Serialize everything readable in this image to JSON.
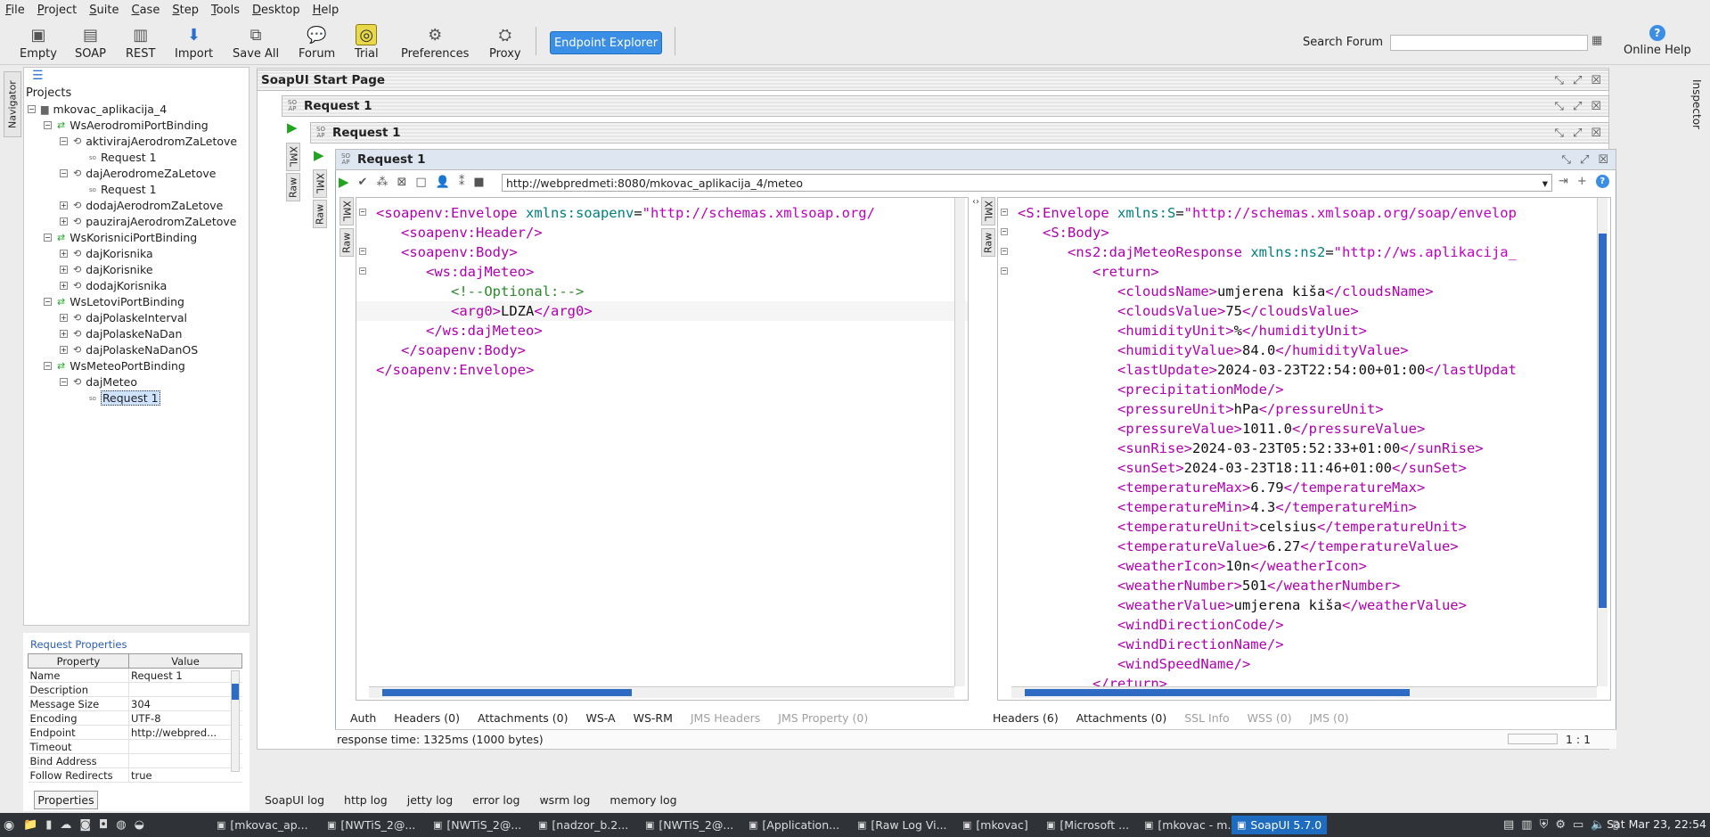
{
  "menu": [
    "File",
    "Project",
    "Suite",
    "Case",
    "Step",
    "Tools",
    "Desktop",
    "Help"
  ],
  "toolbar": {
    "empty": "Empty",
    "soap": "SOAP",
    "rest": "REST",
    "import": "Import",
    "save_all": "Save All",
    "forum": "Forum",
    "trial": "Trial",
    "preferences": "Preferences",
    "proxy": "Proxy",
    "endpoint_explorer": "Endpoint Explorer",
    "search_label": "Search Forum",
    "search_value": "",
    "online_help": "Online Help"
  },
  "side_tabs": {
    "navigator": "Navigator",
    "inspector": "Inspector"
  },
  "navigator": {
    "root_label": "Projects",
    "items": [
      {
        "label": "mkovac_aplikacija_4",
        "kind": "project"
      },
      {
        "label": "WsAerodromiPortBinding",
        "kind": "binding"
      },
      {
        "label": "aktivirajAerodromZaLetove",
        "kind": "op"
      },
      {
        "label": "Request 1",
        "kind": "req"
      },
      {
        "label": "dajAerodromeZaLetove",
        "kind": "op"
      },
      {
        "label": "Request 1",
        "kind": "req"
      },
      {
        "label": "dodajAerodromZaLetove",
        "kind": "op"
      },
      {
        "label": "pauzirajAerodromZaLetove",
        "kind": "op"
      },
      {
        "label": "WsKorisniciPortBinding",
        "kind": "binding"
      },
      {
        "label": "dajKorisnika",
        "kind": "op"
      },
      {
        "label": "dajKorisnike",
        "kind": "op"
      },
      {
        "label": "dodajKorisnika",
        "kind": "op"
      },
      {
        "label": "WsLetoviPortBinding",
        "kind": "binding"
      },
      {
        "label": "dajPolaskeInterval",
        "kind": "op"
      },
      {
        "label": "dajPolaskeNaDan",
        "kind": "op"
      },
      {
        "label": "dajPolaskeNaDanOS",
        "kind": "op"
      },
      {
        "label": "WsMeteoPortBinding",
        "kind": "binding"
      },
      {
        "label": "dajMeteo",
        "kind": "op"
      },
      {
        "label": "Request 1",
        "kind": "req",
        "selected": true
      }
    ]
  },
  "request_properties": {
    "title": "Request Properties",
    "col_property": "Property",
    "col_value": "Value",
    "rows": [
      [
        "Name",
        "Request 1"
      ],
      [
        "Description",
        ""
      ],
      [
        "Message Size",
        "304"
      ],
      [
        "Encoding",
        "UTF-8"
      ],
      [
        "Endpoint",
        "http://webpred..."
      ],
      [
        "Timeout",
        ""
      ],
      [
        "Bind Address",
        ""
      ],
      [
        "Follow Redirects",
        "true"
      ]
    ],
    "button": "Properties"
  },
  "frames": {
    "start_page": "SoapUI Start Page",
    "req_a": "Request 1",
    "req_b": "Request 1",
    "req_c": "Request 1",
    "soap_icon": "SO AP"
  },
  "request_editor": {
    "endpoint": "http://webpredmeti:8080/mkovac_aplikacija_4/meteo",
    "tab_xml": "XML",
    "tab_raw": "Raw",
    "bottom_tabs": [
      "Auth",
      "Headers (0)",
      "Attachments (0)",
      "WS-A",
      "WS-RM"
    ],
    "bottom_tabs_disabled": [
      "JMS Headers",
      "JMS Property (0)"
    ],
    "lines": [
      {
        "indent": 0,
        "parts": [
          [
            "tag",
            "<soapenv:Envelope "
          ],
          [
            "attr",
            "xmlns:soapenv"
          ],
          [
            "txt",
            "="
          ],
          [
            "val",
            "\"http://schemas.xmlsoap.org/"
          ]
        ]
      },
      {
        "indent": 1,
        "parts": [
          [
            "tag",
            "<soapenv:Header/>"
          ]
        ]
      },
      {
        "indent": 1,
        "parts": [
          [
            "tag",
            "<soapenv:Body>"
          ]
        ]
      },
      {
        "indent": 2,
        "parts": [
          [
            "tag",
            "<ws:dajMeteo>"
          ]
        ]
      },
      {
        "indent": 3,
        "parts": [
          [
            "comment",
            "<!--Optional:-->"
          ]
        ]
      },
      {
        "indent": 3,
        "parts": [
          [
            "tag",
            "<arg0>"
          ],
          [
            "txt",
            "LDZA"
          ],
          [
            "tag",
            "</arg0>"
          ]
        ]
      },
      {
        "indent": 2,
        "parts": [
          [
            "tag",
            "</ws:dajMeteo>"
          ]
        ]
      },
      {
        "indent": 1,
        "parts": [
          [
            "tag",
            "</soapenv:Body>"
          ]
        ]
      },
      {
        "indent": 0,
        "parts": [
          [
            "tag",
            "</soapenv:Envelope>"
          ]
        ]
      }
    ]
  },
  "response_editor": {
    "tab_xml": "XML",
    "tab_raw": "Raw",
    "bottom_tabs": [
      "Headers (6)",
      "Attachments (0)"
    ],
    "bottom_tabs_disabled": [
      "SSL Info",
      "WSS (0)",
      "JMS (0)"
    ],
    "lines": [
      {
        "indent": 0,
        "parts": [
          [
            "tag",
            "<S:Envelope "
          ],
          [
            "attr",
            "xmlns:S"
          ],
          [
            "txt",
            "="
          ],
          [
            "val",
            "\"http://schemas.xmlsoap.org/soap/envelop"
          ]
        ]
      },
      {
        "indent": 1,
        "parts": [
          [
            "tag",
            "<S:Body>"
          ]
        ]
      },
      {
        "indent": 2,
        "parts": [
          [
            "tag",
            "<ns2:dajMeteoResponse "
          ],
          [
            "attr",
            "xmlns:ns2"
          ],
          [
            "txt",
            "="
          ],
          [
            "val",
            "\"http://ws.aplikacija_"
          ]
        ]
      },
      {
        "indent": 3,
        "parts": [
          [
            "tag",
            "<return>"
          ]
        ]
      },
      {
        "indent": 4,
        "parts": [
          [
            "tag",
            "<cloudsName>"
          ],
          [
            "txt",
            "umjerena kiša"
          ],
          [
            "tag",
            "</cloudsName>"
          ]
        ]
      },
      {
        "indent": 4,
        "parts": [
          [
            "tag",
            "<cloudsValue>"
          ],
          [
            "txt",
            "75"
          ],
          [
            "tag",
            "</cloudsValue>"
          ]
        ]
      },
      {
        "indent": 4,
        "parts": [
          [
            "tag",
            "<humidityUnit>"
          ],
          [
            "txt",
            "%"
          ],
          [
            "tag",
            "</humidityUnit>"
          ]
        ]
      },
      {
        "indent": 4,
        "parts": [
          [
            "tag",
            "<humidityValue>"
          ],
          [
            "txt",
            "84.0"
          ],
          [
            "tag",
            "</humidityValue>"
          ]
        ]
      },
      {
        "indent": 4,
        "parts": [
          [
            "tag",
            "<lastUpdate>"
          ],
          [
            "txt",
            "2024-03-23T22:54:00+01:00"
          ],
          [
            "tag",
            "</lastUpdat"
          ]
        ]
      },
      {
        "indent": 4,
        "parts": [
          [
            "tag",
            "<precipitationMode/>"
          ]
        ]
      },
      {
        "indent": 4,
        "parts": [
          [
            "tag",
            "<pressureUnit>"
          ],
          [
            "txt",
            "hPa"
          ],
          [
            "tag",
            "</pressureUnit>"
          ]
        ]
      },
      {
        "indent": 4,
        "parts": [
          [
            "tag",
            "<pressureValue>"
          ],
          [
            "txt",
            "1011.0"
          ],
          [
            "tag",
            "</pressureValue>"
          ]
        ]
      },
      {
        "indent": 4,
        "parts": [
          [
            "tag",
            "<sunRise>"
          ],
          [
            "txt",
            "2024-03-23T05:52:33+01:00"
          ],
          [
            "tag",
            "</sunRise>"
          ]
        ]
      },
      {
        "indent": 4,
        "parts": [
          [
            "tag",
            "<sunSet>"
          ],
          [
            "txt",
            "2024-03-23T18:11:46+01:00"
          ],
          [
            "tag",
            "</sunSet>"
          ]
        ]
      },
      {
        "indent": 4,
        "parts": [
          [
            "tag",
            "<temperatureMax>"
          ],
          [
            "txt",
            "6.79"
          ],
          [
            "tag",
            "</temperatureMax>"
          ]
        ]
      },
      {
        "indent": 4,
        "parts": [
          [
            "tag",
            "<temperatureMin>"
          ],
          [
            "txt",
            "4.3"
          ],
          [
            "tag",
            "</temperatureMin>"
          ]
        ]
      },
      {
        "indent": 4,
        "parts": [
          [
            "tag",
            "<temperatureUnit>"
          ],
          [
            "txt",
            "celsius"
          ],
          [
            "tag",
            "</temperatureUnit>"
          ]
        ]
      },
      {
        "indent": 4,
        "parts": [
          [
            "tag",
            "<temperatureValue>"
          ],
          [
            "txt",
            "6.27"
          ],
          [
            "tag",
            "</temperatureValue>"
          ]
        ]
      },
      {
        "indent": 4,
        "parts": [
          [
            "tag",
            "<weatherIcon>"
          ],
          [
            "txt",
            "10n"
          ],
          [
            "tag",
            "</weatherIcon>"
          ]
        ]
      },
      {
        "indent": 4,
        "parts": [
          [
            "tag",
            "<weatherNumber>"
          ],
          [
            "txt",
            "501"
          ],
          [
            "tag",
            "</weatherNumber>"
          ]
        ]
      },
      {
        "indent": 4,
        "parts": [
          [
            "tag",
            "<weatherValue>"
          ],
          [
            "txt",
            "umjerena kiša"
          ],
          [
            "tag",
            "</weatherValue>"
          ]
        ]
      },
      {
        "indent": 4,
        "parts": [
          [
            "tag",
            "<windDirectionCode/>"
          ]
        ]
      },
      {
        "indent": 4,
        "parts": [
          [
            "tag",
            "<windDirectionName/>"
          ]
        ]
      },
      {
        "indent": 4,
        "parts": [
          [
            "tag",
            "<windSpeedName/>"
          ]
        ]
      },
      {
        "indent": 3,
        "parts": [
          [
            "tag",
            "</return>"
          ]
        ]
      }
    ]
  },
  "status": {
    "response_time": "response time: 1325ms (1000 bytes)",
    "position": "1 : 1"
  },
  "log_tabs": [
    "SoapUI log",
    "http log",
    "jetty log",
    "error log",
    "wsrm log",
    "memory log"
  ],
  "taskbar": {
    "tasks": [
      "[mkovac_ap...",
      "[NWTiS_2@...",
      "[NWTiS_2@...",
      "[nadzor_b.2...",
      "[NWTiS_2@...",
      "[Application...",
      "[Raw Log Vi...",
      "[mkovac]",
      "[Microsoft ...",
      "[mkovac - m...",
      "SoapUI 5.7.0"
    ],
    "clock": "Sat Mar 23, 22:54"
  },
  "colors": {
    "accent": "#3a8ee6",
    "xml_tag": "#b000b0",
    "xml_attr": "#007f7f",
    "xml_value": "#c000c0",
    "xml_comment": "#2a8a2a"
  }
}
